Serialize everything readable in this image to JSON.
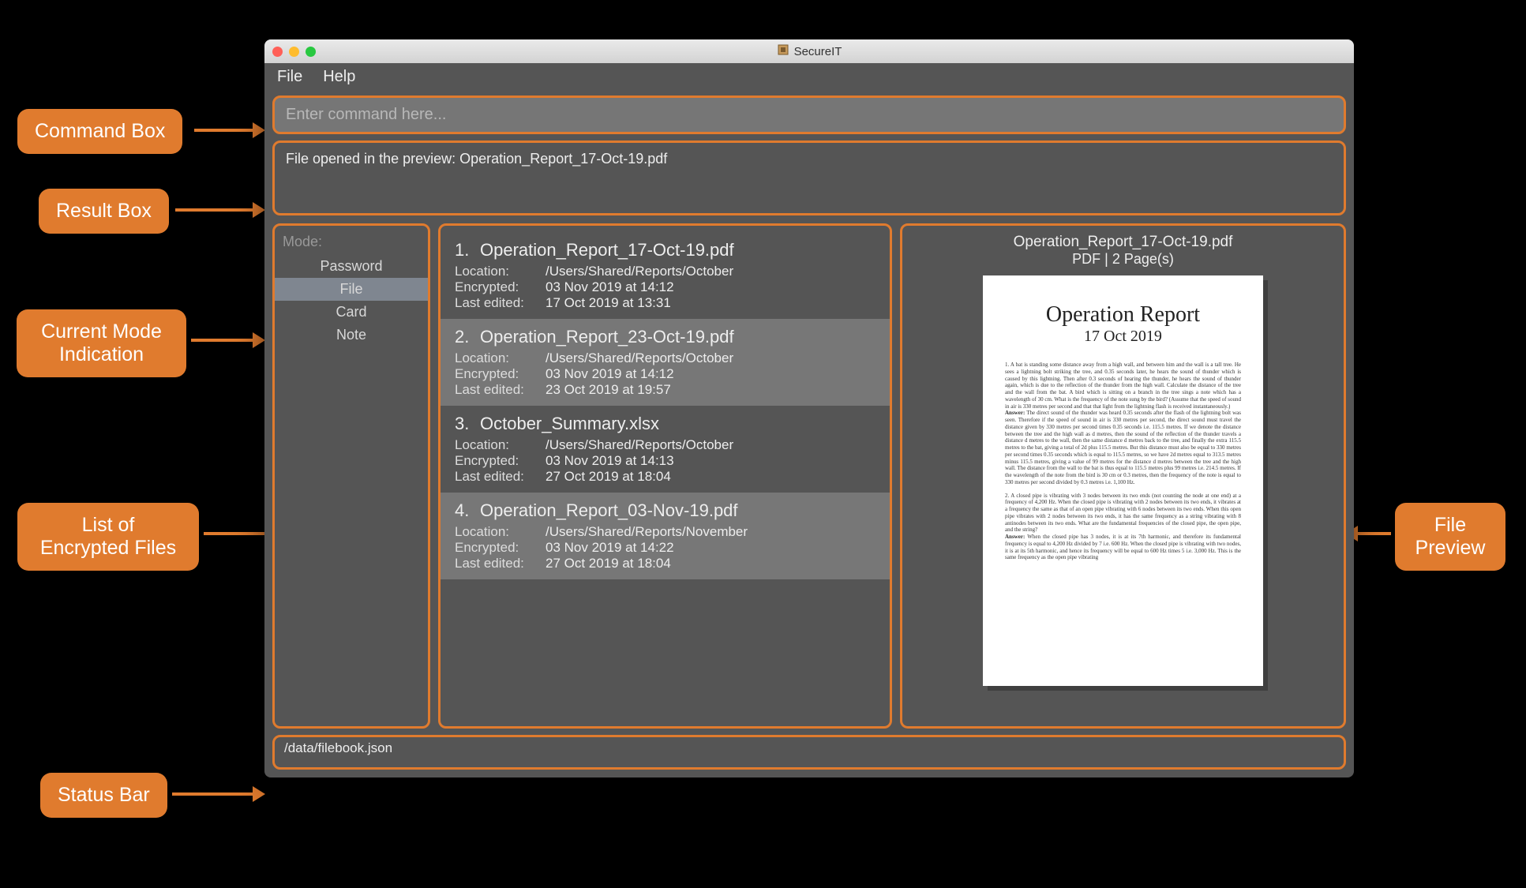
{
  "app": {
    "title": "SecureIT",
    "menu": {
      "file": "File",
      "help": "Help"
    }
  },
  "command": {
    "placeholder": "Enter command here..."
  },
  "result": {
    "text": "File opened in the preview: Operation_Report_17-Oct-19.pdf"
  },
  "mode": {
    "label": "Mode:",
    "items": [
      "Password",
      "File",
      "Card",
      "Note"
    ],
    "active_index": 1
  },
  "field_labels": {
    "location": "Location:",
    "encrypted": "Encrypted:",
    "last_edited": "Last edited:"
  },
  "files": [
    {
      "num": "1.",
      "name": "Operation_Report_17-Oct-19.pdf",
      "location": "/Users/Shared/Reports/October",
      "encrypted": "03 Nov 2019 at 14:12",
      "last_edited": "17 Oct 2019 at 13:31"
    },
    {
      "num": "2.",
      "name": "Operation_Report_23-Oct-19.pdf",
      "location": "/Users/Shared/Reports/October",
      "encrypted": "03 Nov 2019 at 14:12",
      "last_edited": "23 Oct 2019 at 19:57"
    },
    {
      "num": "3.",
      "name": "October_Summary.xlsx",
      "location": "/Users/Shared/Reports/October",
      "encrypted": "03 Nov 2019 at 14:13",
      "last_edited": "27 Oct 2019 at 18:04"
    },
    {
      "num": "4.",
      "name": "Operation_Report_03-Nov-19.pdf",
      "location": "/Users/Shared/Reports/November",
      "encrypted": "03 Nov 2019 at 14:22",
      "last_edited": "27 Oct 2019 at 18:04"
    }
  ],
  "preview": {
    "filename": "Operation_Report_17-Oct-19.pdf",
    "subtitle": "PDF | 2 Page(s)",
    "doc_title": "Operation Report",
    "doc_date": "17 Oct 2019"
  },
  "status": {
    "path": "/data/filebook.json"
  },
  "callouts": {
    "command_box": "Command Box",
    "result_box": "Result Box",
    "mode_indication": "Current Mode\nIndication",
    "file_list": "List of\nEncrypted Files",
    "status_bar": "Status Bar",
    "file_preview": "File\nPreview"
  }
}
